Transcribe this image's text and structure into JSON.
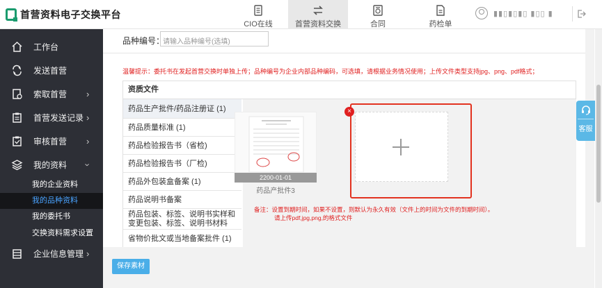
{
  "app": {
    "title": "首营资料电子交换平台"
  },
  "topnav": [
    {
      "label": "CIO在线"
    },
    {
      "label": "首营资料交换"
    },
    {
      "label": "合同"
    },
    {
      "label": "药检单"
    }
  ],
  "user": {
    "name": "▮▮▯▮▯▮▯ ▮▯▯ ▮"
  },
  "sidebar": {
    "items": [
      {
        "label": "工作台"
      },
      {
        "label": "发送首营"
      },
      {
        "label": "索取首营"
      },
      {
        "label": "首营发送记录"
      },
      {
        "label": "审核首营"
      },
      {
        "label": "我的资料"
      },
      {
        "label": "企业信息管理"
      }
    ],
    "subitems": [
      {
        "label": "我的企业资料"
      },
      {
        "label": "我的品种资料"
      },
      {
        "label": "我的委托书"
      },
      {
        "label": "交换资料需求设置"
      }
    ]
  },
  "form": {
    "variety_label": "品种编号：",
    "variety_placeholder": "请输入品种编号(选填)"
  },
  "tip": "温馨提示：委托书在发起首营交换时单独上传；品种编号为企业内部品种编码，可选填，请根据业务情况使用；上传文件类型支持jpg、png、pdf格式；",
  "panel": {
    "title": "资质文件",
    "docs": [
      {
        "label": "药品生产批件/药品注册证 (1)"
      },
      {
        "label": "药品质量标准 (1)"
      },
      {
        "label": "药品检验报告书（省检)"
      },
      {
        "label": "药品检验报告书（厂检)"
      },
      {
        "label": "药品外包装盒备案 (1)"
      },
      {
        "label": "药品说明书备案"
      },
      {
        "label": "药品包装、标签、说明书实样和变更包装、标签、说明书材料"
      },
      {
        "label": "省物价批文或当地备案批件 (1)"
      }
    ]
  },
  "upload": {
    "thumb_date": "2200-01-01",
    "thumb_name": "药品产批件3",
    "note1": "备注：设置到期时间，如果不设置，则默认为永久有效（文件上的时间为文件的到期时间）。",
    "note2": "请上传pdf,jpg,png,的格式文件"
  },
  "actions": {
    "save": "保存素材"
  },
  "kefu": {
    "label": "客服"
  },
  "colors": {
    "accent": "#4aaee8",
    "sidebar": "#2d2f36",
    "warning": "#e02020",
    "brand": "#1a9b6e"
  },
  "icons": [
    "home-icon",
    "send-icon",
    "request-icon",
    "record-icon",
    "review-icon",
    "layers-icon",
    "building-icon",
    "document-icon",
    "exchange-icon",
    "contract-icon",
    "report-icon",
    "user-icon",
    "logout-icon",
    "headset-icon",
    "plus-icon"
  ]
}
